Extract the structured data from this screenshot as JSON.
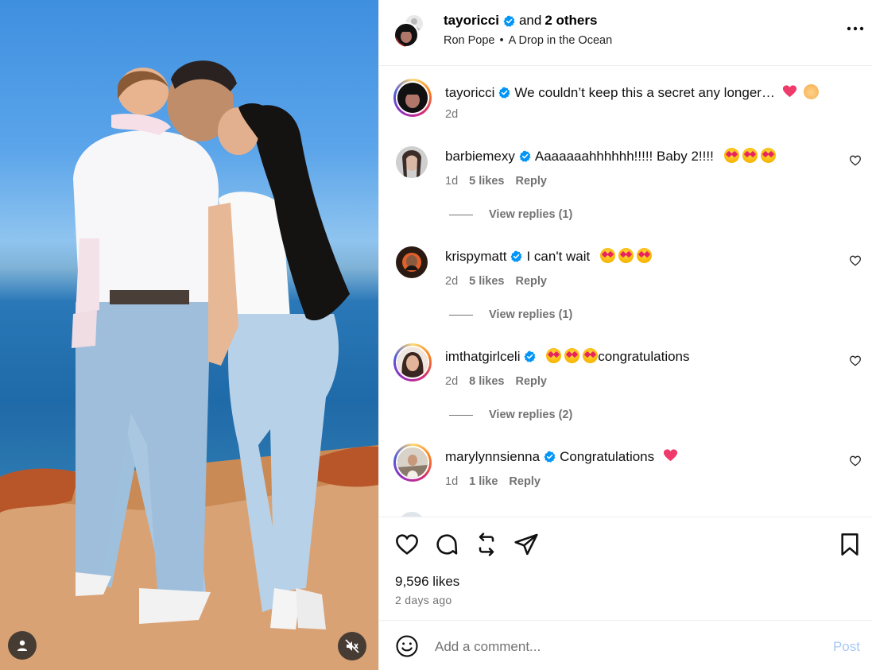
{
  "post": {
    "author": "tayoricci",
    "collab_connector": "and",
    "collab_others": "2 others",
    "audio_artist": "Ron Pope",
    "audio_separator": "•",
    "audio_track": "A Drop in the Ocean"
  },
  "caption": {
    "username": "tayoricci",
    "text": "We couldn’t keep this a secret any longer…",
    "time": "2d"
  },
  "comments": [
    {
      "username": "barbiemexy",
      "text": "Aaaaaaahhhhhh!!!!! Baby 2!!!!",
      "time": "1d",
      "likes": "5 likes",
      "reply": "Reply",
      "view_replies": "View replies (1)"
    },
    {
      "username": "krispymatt",
      "text": "I can't wait",
      "time": "2d",
      "likes": "5 likes",
      "reply": "Reply",
      "view_replies": "View replies (1)"
    },
    {
      "username": "imthatgirlceli",
      "text": "congratulations",
      "time": "2d",
      "likes": "8 likes",
      "reply": "Reply",
      "view_replies": "View replies (2)"
    },
    {
      "username": "marylynnsienna",
      "text": "Congratulations",
      "time": "1d",
      "likes": "1 like",
      "reply": "Reply"
    }
  ],
  "engagement": {
    "likes": "9,596 likes",
    "time_ago": "2 days ago"
  },
  "comment_box": {
    "placeholder": "Add a comment...",
    "post_label": "Post"
  },
  "icons": {
    "verified": "verified-badge-icon",
    "more": "more-options-icon",
    "like": "heart-icon",
    "comment": "comment-icon",
    "repost": "repost-icon",
    "share": "share-icon",
    "save": "bookmark-icon",
    "emoji": "emoji-icon",
    "tagged_users": "user-icon",
    "muted": "muted-speaker-icon"
  },
  "colors": {
    "verified_blue": "#0095f6",
    "post_button_disabled": "#a8c9f5",
    "secondary_text": "#737373"
  }
}
